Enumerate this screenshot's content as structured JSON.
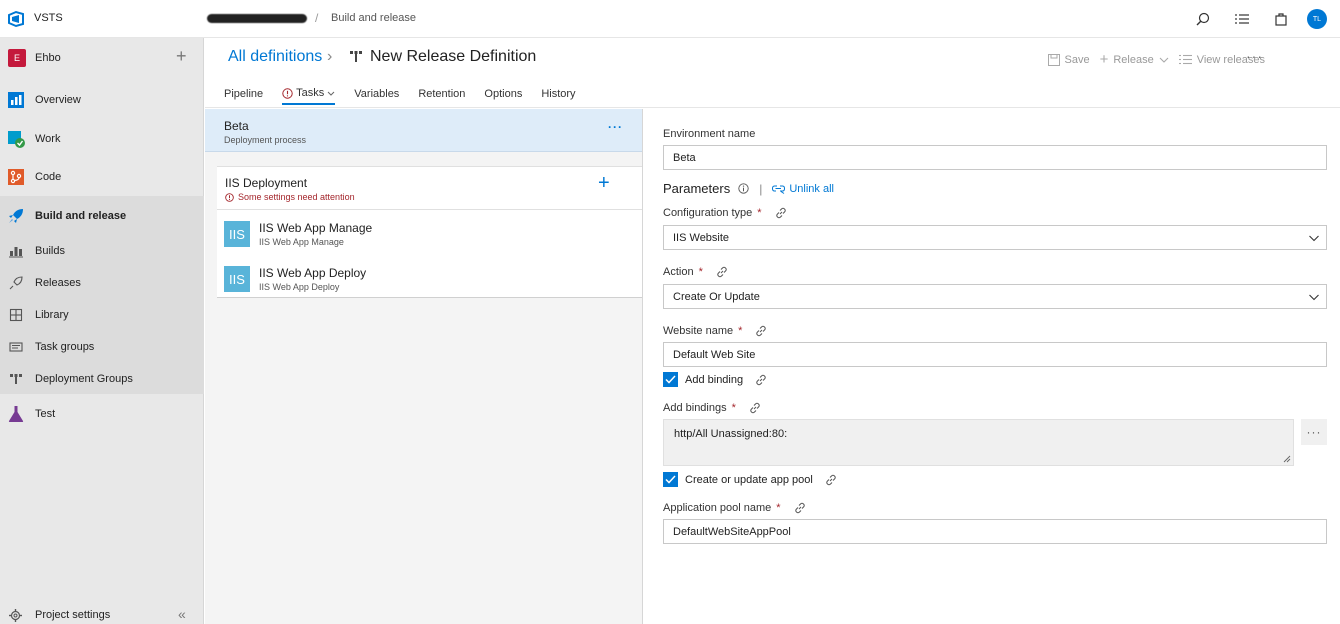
{
  "topbar": {
    "app_name": "VSTS",
    "breadcrumb_separator": "/",
    "breadcrumb_page": "Build and release",
    "avatar_initials": "TL",
    "icons": [
      "search-icon",
      "list-icon",
      "marketplace-icon",
      "avatar"
    ]
  },
  "sidebar": {
    "project_initial": "E",
    "project_name": "Ehbo",
    "add_symbol": "+",
    "items": [
      {
        "label": "Overview",
        "icon": "overview-icon"
      },
      {
        "label": "Work",
        "icon": "work-icon"
      },
      {
        "label": "Code",
        "icon": "code-icon"
      },
      {
        "label": "Build and release",
        "icon": "rocket-icon"
      },
      {
        "label": "Builds",
        "icon": "builds-icon"
      },
      {
        "label": "Releases",
        "icon": "releases-icon"
      },
      {
        "label": "Library",
        "icon": "library-icon"
      },
      {
        "label": "Task groups",
        "icon": "task-groups-icon"
      },
      {
        "label": "Deployment Groups",
        "icon": "deployment-groups-icon"
      },
      {
        "label": "Test",
        "icon": "test-icon"
      }
    ],
    "footer_label": "Project settings",
    "collapse_symbol": "«"
  },
  "header": {
    "all_definitions": "All definitions",
    "chevron": "›",
    "title": "New Release Definition",
    "actions": {
      "save": "Save",
      "release": "Release",
      "view_releases": "View releases"
    },
    "more": "···",
    "tabs": [
      "Pipeline",
      "Tasks",
      "Variables",
      "Retention",
      "Options",
      "History"
    ]
  },
  "middle": {
    "environment": {
      "name": "Beta",
      "subtitle": "Deployment process",
      "more": "···"
    },
    "phase": {
      "title": "IIS Deployment",
      "warning": "Some settings need attention",
      "add": "+"
    },
    "tasks": [
      {
        "icon_text": "IIS",
        "name": "IIS Web App Manage",
        "subtitle": "IIS Web App Manage"
      },
      {
        "icon_text": "IIS",
        "name": "IIS Web App Deploy",
        "subtitle": "IIS Web App Deploy"
      }
    ]
  },
  "form": {
    "env_name_label": "Environment name",
    "env_name_value": "Beta",
    "params_label": "Parameters",
    "params_sep": "|",
    "unlink_all": "Unlink all",
    "required_mark": "*",
    "config_type_label": "Configuration type",
    "config_type_value": "IIS Website",
    "action_label": "Action",
    "action_value": "Create Or Update",
    "website_name_label": "Website name",
    "website_name_value": "Default Web Site",
    "add_binding_label": "Add binding",
    "add_bindings_label": "Add bindings",
    "add_bindings_value": "http/All Unassigned:80:",
    "bindings_more": "···",
    "app_pool_check_label": "Create or update app pool",
    "app_pool_name_label": "Application pool name",
    "app_pool_name_value": "DefaultWebSiteAppPool"
  },
  "colors": {
    "accent": "#0078d4",
    "warning": "#a4262c",
    "selected_env": "#deecf9",
    "task_icon": "#59b4d9"
  }
}
